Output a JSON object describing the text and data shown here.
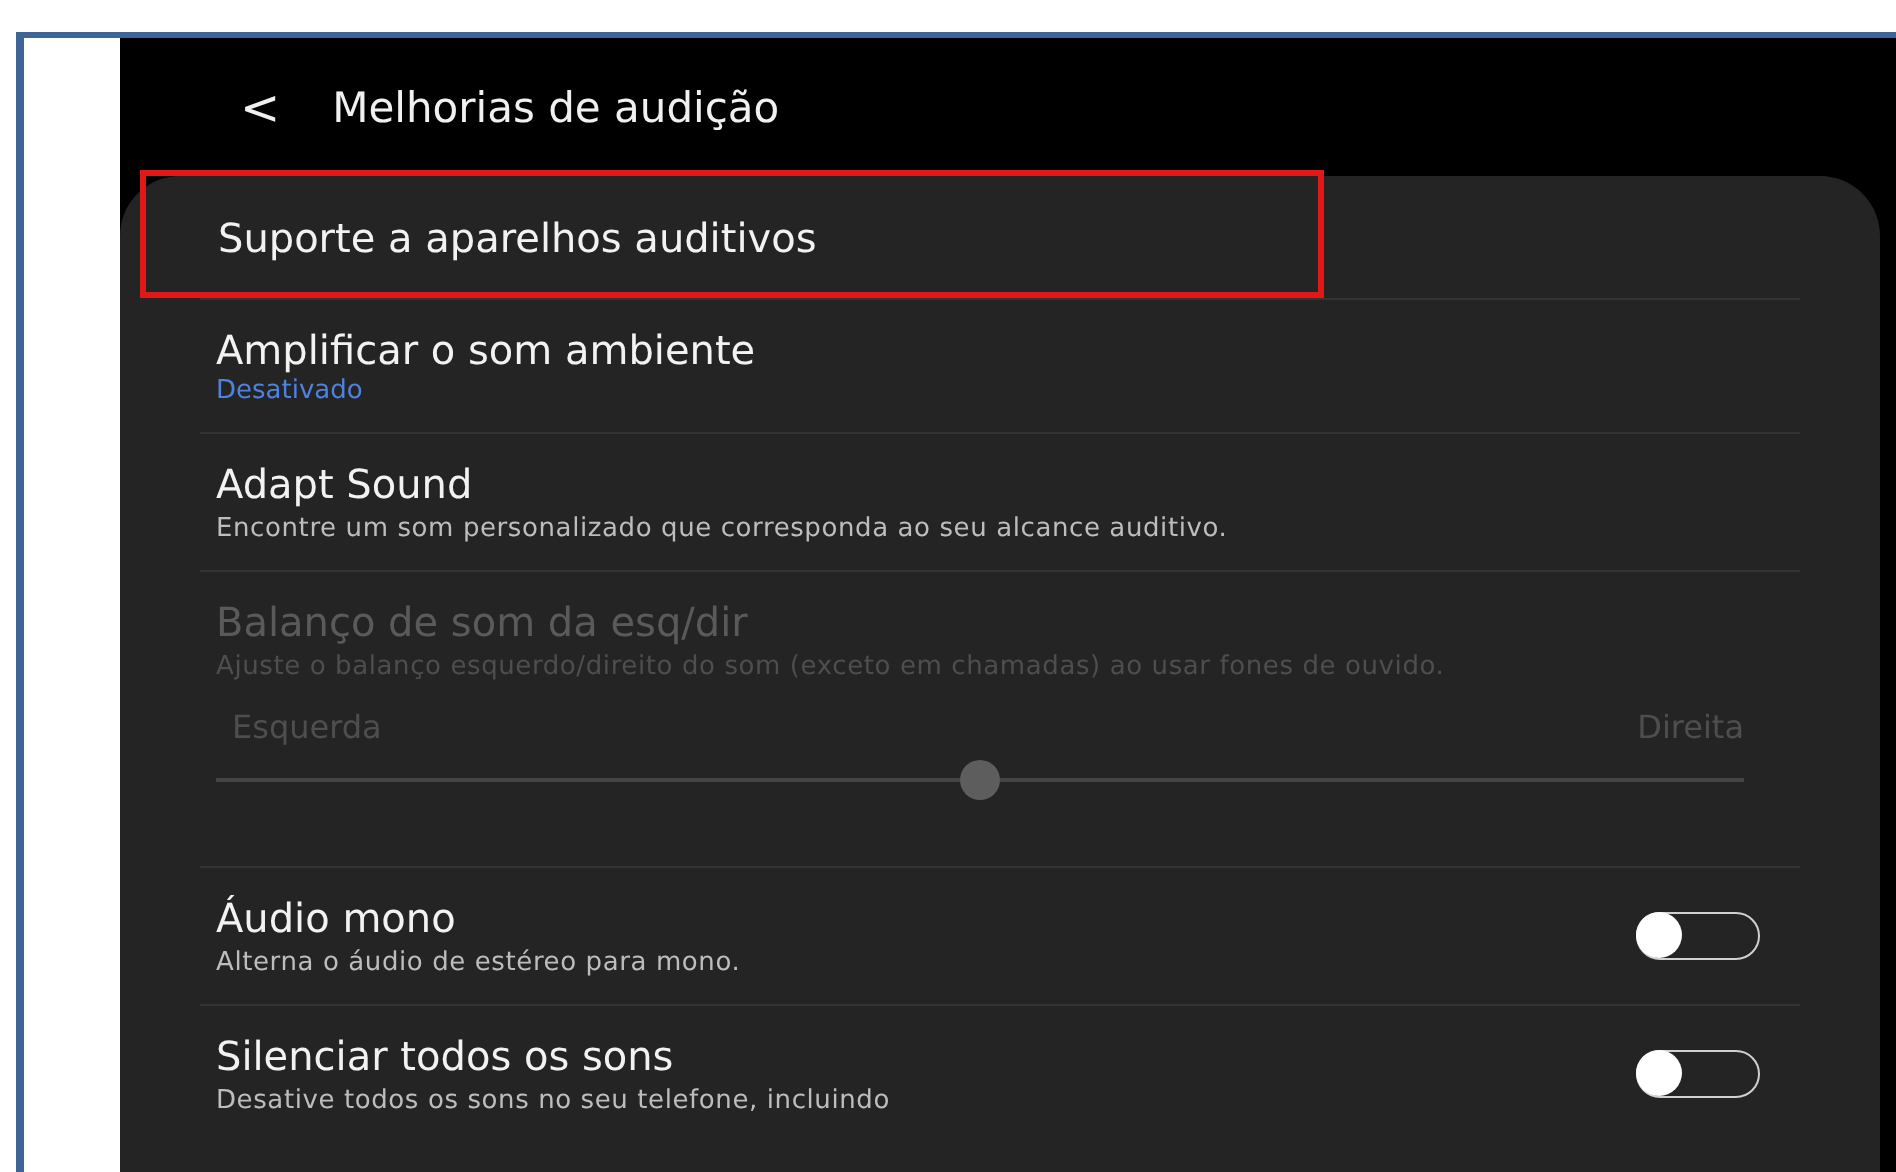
{
  "header": {
    "back_icon": "<",
    "title": "Melhorias de audição"
  },
  "settings": [
    {
      "kind": "link",
      "title": "Suporte a aparelhos auditivos",
      "highlighted": true
    },
    {
      "kind": "summary",
      "title": "Amplificar o som ambiente",
      "summary": "Desativado"
    },
    {
      "kind": "link",
      "title": "Adapt Sound",
      "description": "Encontre um som personalizado que corresponda ao seu alcance auditivo."
    },
    {
      "kind": "slider",
      "title": "Balanço de som da esq/dir",
      "description": "Ajuste o balanço esquerdo/direito do som (exceto em chamadas) ao usar fones de ouvido.",
      "left_label": "Esquerda",
      "right_label": "Direita",
      "level": 0.5,
      "disabled": true
    },
    {
      "kind": "switch",
      "title": "Áudio mono",
      "description": "Alterna o áudio de estéreo para mono.",
      "on": false
    },
    {
      "kind": "switch",
      "title": "Silenciar todos os sons",
      "description": "Desative todos os sons no seu telefone, incluindo",
      "on": false
    }
  ]
}
